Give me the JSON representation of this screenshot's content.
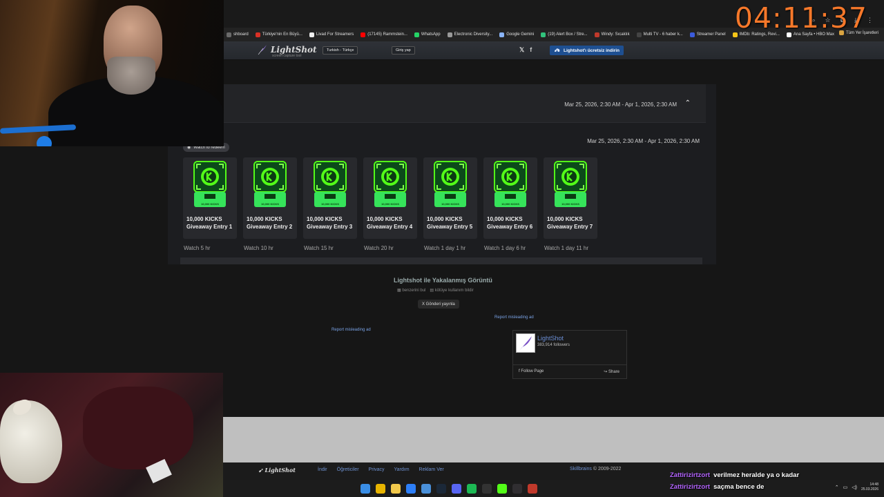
{
  "timer": "04:11:37",
  "bookmarks": [
    {
      "label": "shboard",
      "color": "#6a6a6a"
    },
    {
      "label": "Türkiye'nin En Büyü...",
      "color": "#d93025"
    },
    {
      "label": "Livad For Streamers",
      "color": "#eeeeee"
    },
    {
      "label": "(17145) Rammstein...",
      "color": "#ff0000"
    },
    {
      "label": "WhatsApp",
      "color": "#25d366"
    },
    {
      "label": "Electronic Diversity...",
      "color": "#999999"
    },
    {
      "label": "Google Gemini",
      "color": "#8ab4f8"
    },
    {
      "label": "(19) Alert Box / Stre...",
      "color": "#31c27c"
    },
    {
      "label": "Windy: Sıcaklık",
      "color": "#c0392b"
    },
    {
      "label": "Multi TV - 6 haber k...",
      "color": "#444444"
    },
    {
      "label": "Streamer Panel",
      "color": "#3b5bdb"
    },
    {
      "label": "IMDb: Ratings, Revi...",
      "color": "#f5c518"
    },
    {
      "label": "Ana Sayfa • HBO Max",
      "color": "#ffffff"
    }
  ],
  "bookmarks_all": "Tüm Yer İşaretleri",
  "lightshot_header": {
    "brand": "LightShot",
    "tagline": "screen capture tool",
    "language": "Turkish - Türkçe",
    "login": "Giriş yap",
    "twitter": "𝕏",
    "facebook": "f",
    "download": "Lightshot'ı ücretsiz indirin"
  },
  "panel": {
    "date_range_top": "Mar 25, 2026, 2:30 AM - Apr 1, 2026, 2:30 AM",
    "date_range_inner": "Mar 25, 2026, 2:30 AM - Apr 1, 2026, 2:30 AM",
    "watch_pill": "Watch to redeem",
    "badge_text": "10,000 KICKS",
    "cards": [
      {
        "title1": "10,000 KICKS",
        "title2": "Giveaway Entry 1",
        "sub": "Watch 5 hr"
      },
      {
        "title1": "10,000 KICKS",
        "title2": "Giveaway Entry 2",
        "sub": "Watch 10 hr"
      },
      {
        "title1": "10,000 KICKS",
        "title2": "Giveaway Entry 3",
        "sub": "Watch 15 hr"
      },
      {
        "title1": "10,000 KICKS",
        "title2": "Giveaway Entry 4",
        "sub": "Watch 20 hr"
      },
      {
        "title1": "10,000 KICKS",
        "title2": "Giveaway Entry 5",
        "sub": "Watch 1 day 1 hr"
      },
      {
        "title1": "10,000 KICKS",
        "title2": "Giveaway Entry 6",
        "sub": "Watch 1 day 6 hr"
      },
      {
        "title1": "10,000 KICKS",
        "title2": "Giveaway Entry 7",
        "sub": "Watch 1 day 11 hr"
      }
    ]
  },
  "below": {
    "caption": "Lightshot ile Yakalanmış Görüntü",
    "similar": "benzerini bul",
    "abuse": "kötüye kullanım bildir",
    "tweet": "X Gönderi yayınla",
    "report1": "Report misleading ad",
    "report2": "Report misleading ad"
  },
  "fb": {
    "name": "LightShot",
    "followers": "383,914 followers",
    "follow": "Follow Page",
    "share": "Share"
  },
  "footer": {
    "brand": "LightShot",
    "links": [
      "İndir",
      "Öğreticiler",
      "Privacy",
      "Yardım",
      "Reklam Ver"
    ],
    "company": "Skillbrains",
    "copyright": "© 2009-2022"
  },
  "chat": [
    {
      "user": "Zattirizirtzort",
      "message": "verilmez heralde ya o kadar"
    },
    {
      "user": "Zattirizirtzort",
      "message": "saçma bence de"
    }
  ],
  "taskbar": {
    "icons": [
      {
        "name": "windows-start",
        "color": "#3a8ee6"
      },
      {
        "name": "chrome",
        "color": "#e8b400"
      },
      {
        "name": "file-explorer",
        "color": "#f2c94c"
      },
      {
        "name": "app-blue",
        "color": "#2d7ff9"
      },
      {
        "name": "app-blue-2",
        "color": "#4a90d9"
      },
      {
        "name": "steam",
        "color": "#1b2838"
      },
      {
        "name": "discord",
        "color": "#5865f2"
      },
      {
        "name": "spotify",
        "color": "#1db954"
      },
      {
        "name": "epic-games",
        "color": "#333333"
      },
      {
        "name": "kick",
        "color": "#53fc18"
      },
      {
        "name": "obs",
        "color": "#302e31"
      },
      {
        "name": "recorder",
        "color": "#c0392b"
      }
    ],
    "time": "14:48",
    "date": "25.03.2026"
  },
  "colors": {
    "accent_orange": "#f6782a",
    "kick_green": "#53fc18",
    "link_blue": "#6f93d4"
  }
}
